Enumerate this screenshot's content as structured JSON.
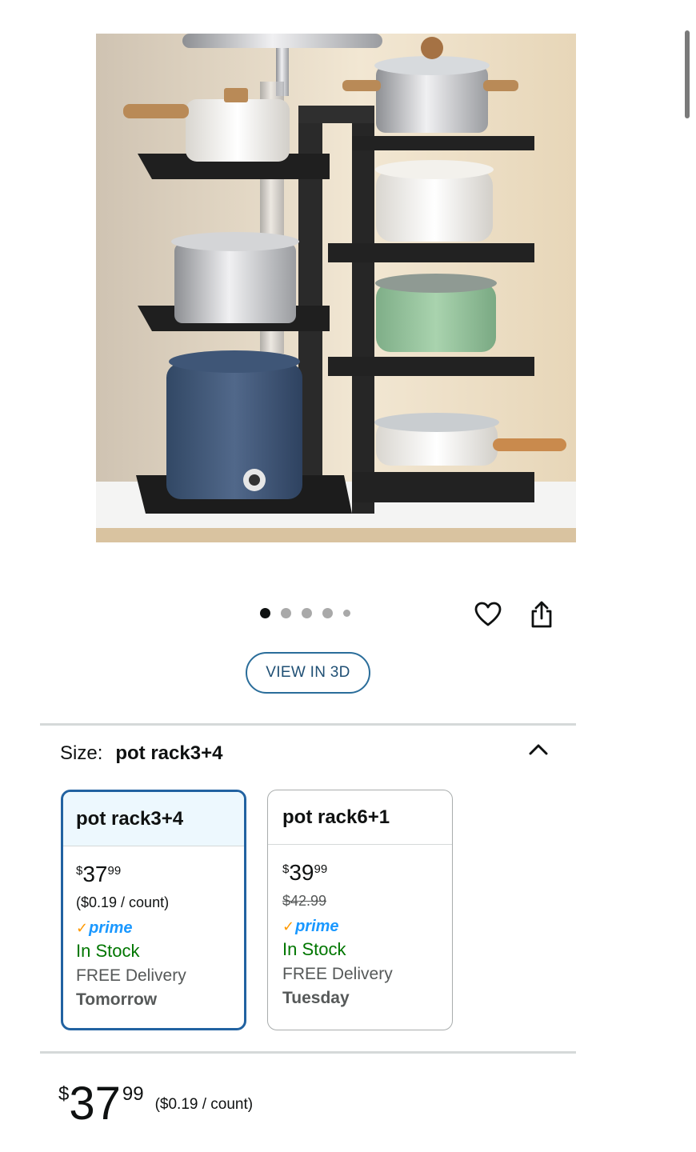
{
  "gallery": {
    "image_alt": "pot rack with pots",
    "dots": [
      {
        "state": "active"
      },
      {
        "state": "inactive"
      },
      {
        "state": "inactive"
      },
      {
        "state": "inactive"
      },
      {
        "state": "inactive-small"
      }
    ],
    "heart_icon": "heart-icon",
    "share_icon": "share-icon"
  },
  "view3d": {
    "label": "VIEW IN 3D"
  },
  "size": {
    "label": "Size:",
    "value": "pot rack3+4",
    "chevron_icon": "chevron-up-icon"
  },
  "options": [
    {
      "name": "pot rack3+4",
      "price_currency": "$",
      "price_whole": "37",
      "price_fraction": "99",
      "unit_price": "($0.19 / count)",
      "prime_label": "prime",
      "availability": "In Stock",
      "delivery": "FREE Delivery",
      "delivery_day": "Tomorrow",
      "selected": true
    },
    {
      "name": "pot rack6+1",
      "price_currency": "$",
      "price_whole": "39",
      "price_fraction": "99",
      "list_price": "$42.99",
      "prime_label": "prime",
      "availability": "In Stock",
      "delivery": "FREE Delivery",
      "delivery_day": "Tuesday",
      "selected": false
    }
  ],
  "price": {
    "currency": "$",
    "whole": "37",
    "fraction": "99",
    "unit_price": "($0.19 / count)"
  },
  "colors": {
    "accent_blue": "#2162a1",
    "selected_bg": "#edf8fe",
    "in_stock_green": "#007600",
    "prime_blue": "#1a98ff",
    "prime_check": "#ff9900"
  }
}
